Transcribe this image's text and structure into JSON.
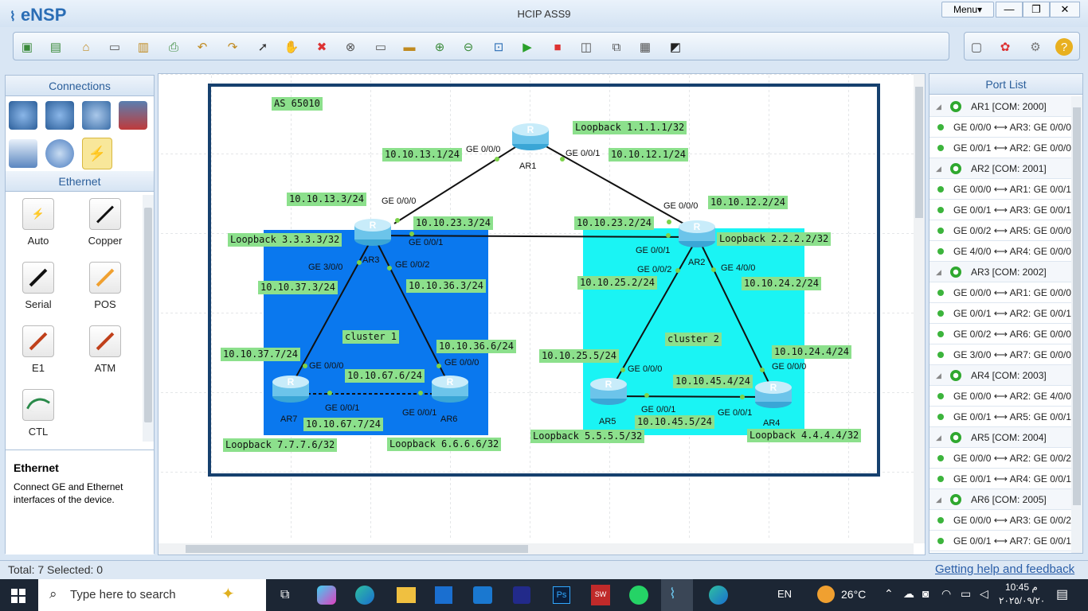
{
  "app": {
    "logo": "eNSP",
    "title": "HCIP ASS9",
    "menu": "Menu▾",
    "min": "—",
    "restore": "❐",
    "close": "✕"
  },
  "left": {
    "connections": "Connections",
    "ethernet_head": "Ethernet",
    "cables": [
      {
        "label": "Auto"
      },
      {
        "label": "Copper"
      },
      {
        "label": "Serial"
      },
      {
        "label": "POS"
      },
      {
        "label": "E1"
      },
      {
        "label": "ATM"
      },
      {
        "label": "CTL"
      }
    ],
    "desc_title": "Ethernet",
    "desc_text": "Connect GE and Ethernet interfaces of the device."
  },
  "topology": {
    "as": "AS 65010",
    "clusters": [
      "cluster 1",
      "cluster 2"
    ],
    "routers": [
      "AR1",
      "AR2",
      "AR3",
      "AR4",
      "AR5",
      "AR6",
      "AR7"
    ],
    "labels": [
      "Loopback 1.1.1.1/32",
      "10.10.13.1/24",
      "10.10.12.1/24",
      "10.10.13.3/24",
      "10.10.23.3/24",
      "10.10.23.2/24",
      "10.10.12.2/24",
      "Loopback 3.3.3.3/32",
      "Loopback 2.2.2.2/32",
      "10.10.37.3/24",
      "10.10.36.3/24",
      "10.10.25.2/24",
      "10.10.24.2/24",
      "cluster 1",
      "cluster 2",
      "10.10.37.7/24",
      "10.10.36.6/24",
      "10.10.25.5/24",
      "10.10.24.4/24",
      "10.10.67.6/24",
      "10.10.45.4/24",
      "10.10.67.7/24",
      "10.10.45.5/24",
      "Loopback 7.7.7.6/32",
      "Loopback 6.6.6.6/32",
      "Loopback 5.5.5.5/32",
      "Loopback 4.4.4.4/32"
    ],
    "ports": [
      "GE 0/0/0",
      "GE 0/0/1",
      "GE 0/0/0",
      "GE 0/0/0",
      "GE 0/0/1",
      "GE 0/0/1",
      "GE 3/0/0",
      "GE 0/0/2",
      "GE 0/0/2",
      "GE 4/0/0",
      "GE 0/0/0",
      "GE 0/0/0",
      "GE 0/0/0",
      "GE 0/0/0",
      "GE 0/0/1",
      "GE 0/0/1",
      "GE 0/0/1",
      "GE 0/0/1"
    ]
  },
  "portlist": {
    "title": "Port List",
    "rows": [
      {
        "h": true,
        "t": "AR1 [COM: 2000]"
      },
      {
        "t": "GE 0/0/0 ⟷ AR3: GE 0/0/0"
      },
      {
        "t": "GE 0/0/1 ⟷ AR2: GE 0/0/0"
      },
      {
        "h": true,
        "t": "AR2 [COM: 2001]"
      },
      {
        "t": "GE 0/0/0 ⟷ AR1: GE 0/0/1"
      },
      {
        "t": "GE 0/0/1 ⟷ AR3: GE 0/0/1"
      },
      {
        "t": "GE 0/0/2 ⟷ AR5: GE 0/0/0"
      },
      {
        "t": "GE 4/0/0 ⟷ AR4: GE 0/0/0"
      },
      {
        "h": true,
        "t": "AR3 [COM: 2002]"
      },
      {
        "t": "GE 0/0/0 ⟷ AR1: GE 0/0/0"
      },
      {
        "t": "GE 0/0/1 ⟷ AR2: GE 0/0/1"
      },
      {
        "t": "GE 0/0/2 ⟷ AR6: GE 0/0/0"
      },
      {
        "t": "GE 3/0/0 ⟷ AR7: GE 0/0/0"
      },
      {
        "h": true,
        "t": "AR4 [COM: 2003]"
      },
      {
        "t": "GE 0/0/0 ⟷ AR2: GE 4/0/0"
      },
      {
        "t": "GE 0/0/1 ⟷ AR5: GE 0/0/1"
      },
      {
        "h": true,
        "t": "AR5 [COM: 2004]"
      },
      {
        "t": "GE 0/0/0 ⟷ AR2: GE 0/0/2"
      },
      {
        "t": "GE 0/0/1 ⟷ AR4: GE 0/0/1"
      },
      {
        "h": true,
        "t": "AR6 [COM: 2005]"
      },
      {
        "t": "GE 0/0/0 ⟷ AR3: GE 0/0/2"
      },
      {
        "t": "GE 0/0/1 ⟷ AR7: GE 0/0/1"
      }
    ]
  },
  "status": {
    "total": "Total: 7  Selected: 0",
    "help": "Getting help and feedback"
  },
  "taskbar": {
    "search": "Type here to search",
    "lang": "EN",
    "temp": "26°C",
    "time": "10:45 م",
    "date": "٢٠٢٥/٠٩/٢٠"
  }
}
